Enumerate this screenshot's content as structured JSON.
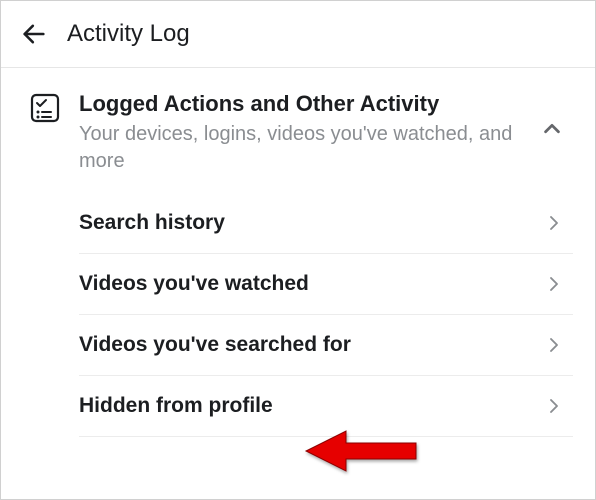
{
  "header": {
    "title": "Activity Log"
  },
  "section": {
    "title": "Logged Actions and Other Activity",
    "subtitle": "Your devices, logins, videos you've watched, and more"
  },
  "items": [
    {
      "label": "Search history"
    },
    {
      "label": "Videos you've watched"
    },
    {
      "label": "Videos you've searched for"
    },
    {
      "label": "Hidden from profile"
    }
  ]
}
